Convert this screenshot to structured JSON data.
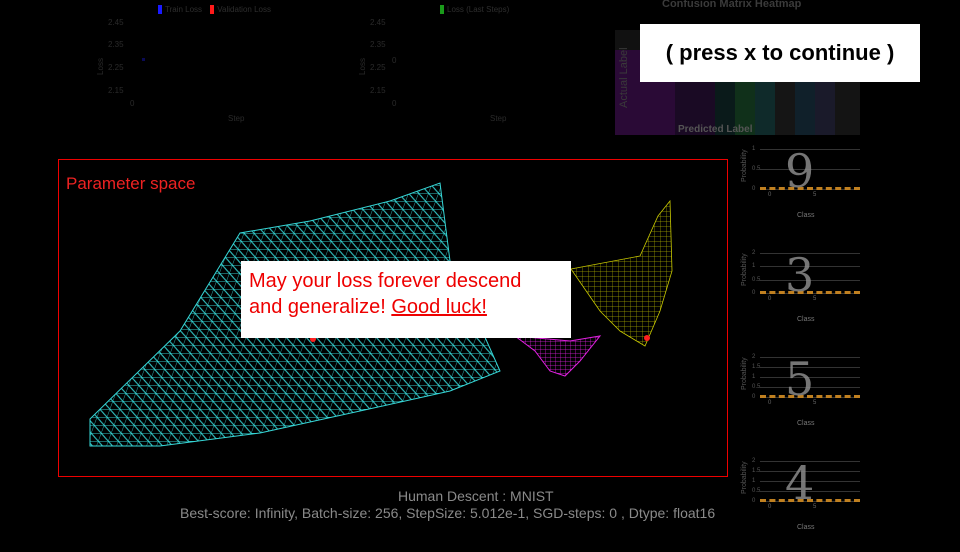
{
  "loss_chart": {
    "legend": [
      {
        "label": "Train Loss",
        "color": "#1a1aff"
      },
      {
        "label": "Validation Loss",
        "color": "#ff1a1a"
      }
    ],
    "yticks": [
      "2.45",
      "2.35",
      "2.25",
      "2.15",
      "0"
    ],
    "ylabel": "Loss",
    "xlabel": "Step"
  },
  "last_chart": {
    "legend": [
      {
        "label": "Loss (Last Steps)",
        "color": "#1a9a1a"
      }
    ],
    "yticks": [
      "2.45",
      "2.35",
      "2.25",
      "2.15",
      "0"
    ],
    "ylabel": "Loss",
    "xlabel": "Step",
    "zero_mark": "0"
  },
  "heatmap": {
    "title": "Confusion Matrix Heatmap",
    "ylabel": "Actual Label",
    "xlabel": "Predicted Label"
  },
  "overlay": {
    "press_x": "( press x to continue )"
  },
  "parameter_space": {
    "label": "Parameter space",
    "message_line1": "May your loss forever descend",
    "message_line2": "and generalize! ",
    "message_link": "Good luck!",
    "colors": {
      "surface_main": "#36d6d6",
      "surface_b": "#e020e0",
      "surface_c": "#d8d800",
      "marker": "#ff2020"
    }
  },
  "footer": {
    "title": "Human Descent : MNIST",
    "status": "Best-score: Infinity, Batch-size: 256, StepSize: 5.012e-1, SGD-steps: 0 , Dtype: float16"
  },
  "digits": [
    {
      "digit": "9",
      "ylabel": "Probability",
      "xlabel": "Class",
      "yticks": [
        "1",
        "0.5",
        "0"
      ],
      "xticks": [
        "0",
        "5"
      ]
    },
    {
      "digit": "3",
      "ylabel": "Probability",
      "xlabel": "Class",
      "yticks": [
        "2",
        "1",
        "0.5",
        "0"
      ],
      "xticks": [
        "0",
        "5"
      ]
    },
    {
      "digit": "5",
      "ylabel": "Probability",
      "xlabel": "Class",
      "yticks": [
        "2",
        "1.5",
        "1",
        "0.5",
        "0"
      ],
      "xticks": [
        "0",
        "5"
      ]
    },
    {
      "digit": "4",
      "ylabel": "Probability",
      "xlabel": "Class",
      "yticks": [
        "2",
        "1.5",
        "1",
        "0.5",
        "0"
      ],
      "xticks": [
        "0",
        "5"
      ]
    }
  ]
}
